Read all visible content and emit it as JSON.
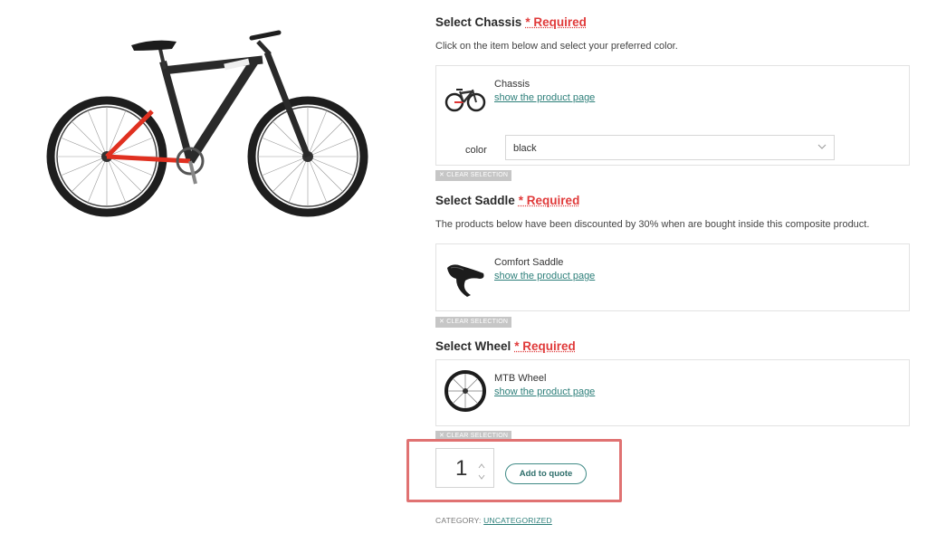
{
  "sections": [
    {
      "title": "Select Chassis",
      "required": "* Required",
      "description": "Click on the item below and select your preferred color.",
      "product": {
        "name": "Chassis",
        "link": "show the product page"
      },
      "option": {
        "label": "color",
        "value": "black"
      },
      "clear": "✕ CLEAR SELECTION"
    },
    {
      "title": "Select Saddle",
      "required": "* Required",
      "description": "The products below have been discounted by 30% when are bought inside this composite product.",
      "product": {
        "name": "Comfort Saddle",
        "link": "show the product page"
      },
      "clear": "✕ CLEAR SELECTION"
    },
    {
      "title": "Select Wheel",
      "required": "* Required",
      "product": {
        "name": "MTB Wheel",
        "link": "show the product page"
      },
      "clear": "✕ CLEAR SELECTION"
    }
  ],
  "quantity": "1",
  "add_to_quote": "Add to quote",
  "category": {
    "label": "CATEGORY:",
    "value": "UNCATEGORIZED"
  },
  "colors": {
    "accent": "#2d7f7a",
    "required": "#e03a3a",
    "highlight": "#e07272",
    "bike_red": "#e03020"
  }
}
